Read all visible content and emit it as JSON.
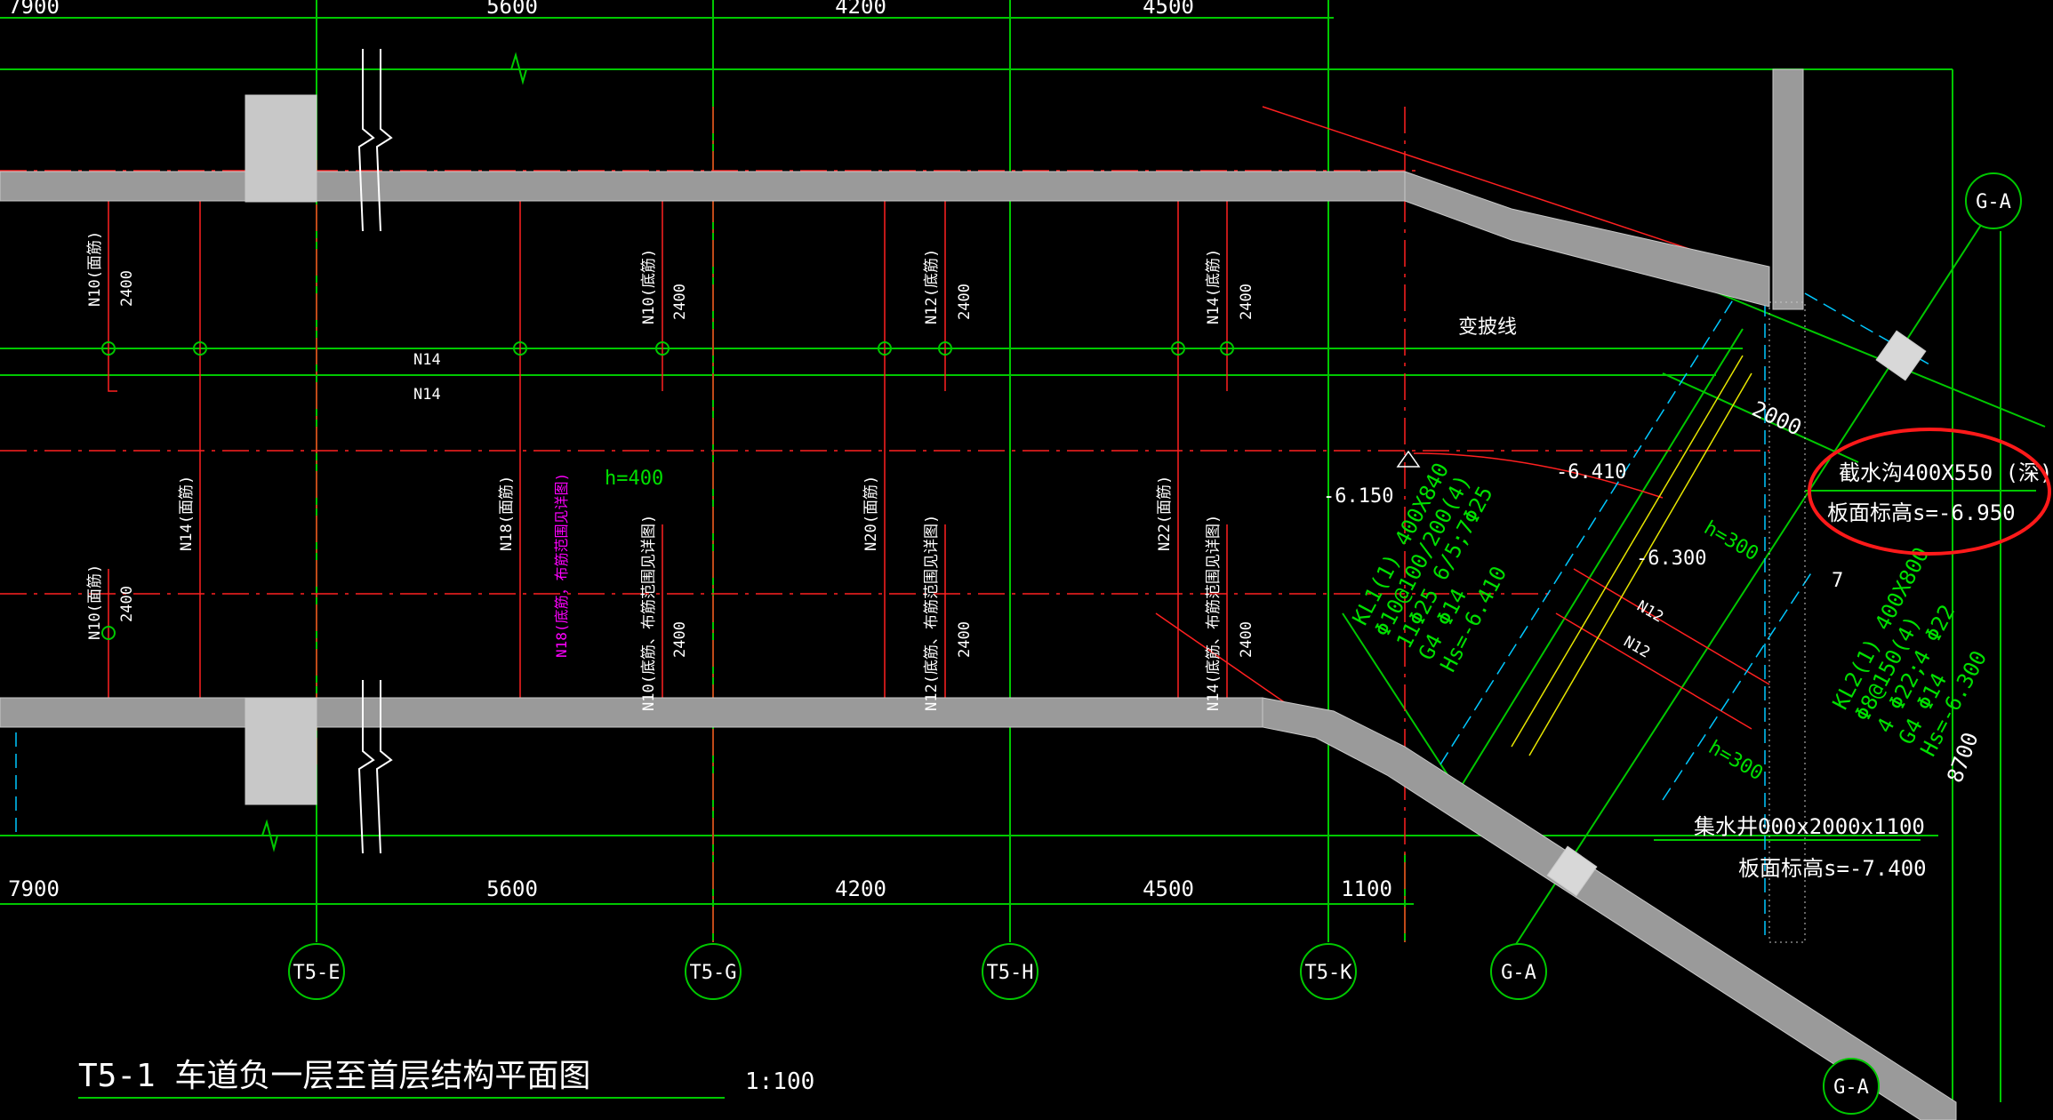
{
  "drawing": {
    "title": "T5-1 车道负一层至首层结构平面图",
    "scale": "1:100"
  },
  "dimensions": {
    "top": [
      "7900",
      "5600",
      "4200",
      "4500"
    ],
    "bottom": [
      "7900",
      "5600",
      "4200",
      "4500",
      "1100"
    ],
    "right": "8700",
    "diagonal": "2000"
  },
  "axis_bubbles": [
    "T5-E",
    "T5-G",
    "T5-H",
    "T5-K",
    "G-A",
    "G-A",
    "G-A"
  ],
  "rebar_labels": {
    "n10_top": "N10(面筋)",
    "n10_bot": "N10(面筋)",
    "n14_mid": "N14(面筋)",
    "n18_mid": "N18(面筋)",
    "n18_magenta": "N18(底筋，布筋范围见详图)",
    "n10_b": "N10(底筋)",
    "n10_b2": "N10(底筋、布筋范围见详图)",
    "n20": "N20(面筋)",
    "n12_b": "N12(底筋)",
    "n12_b2": "N12(底筋、布筋范围见详图)",
    "n14_b": "N14(底筋)",
    "n22": "N22(面筋)",
    "n14_b2": "N14(底筋、布筋范围见详图)",
    "n14_line1": "N14",
    "n14_line2": "N14",
    "n12_a": "N12",
    "n12_b_diag": "N12",
    "len_2400": "2400"
  },
  "annotations": {
    "slope_line": "变披线",
    "h400": "h=400",
    "h300_a": "h=300",
    "h300_b": "h=300",
    "elev_6150": "-6.150",
    "elev_6410": "-6.410",
    "elev_6300": "-6.300",
    "kl1_l1": "KL1(1) 400X840",
    "kl1_l2": "Φ10@100/200(4)",
    "kl1_l3": "11Φ25 6/5;7Φ25",
    "kl1_l4": "G4 Φ14",
    "kl1_l5": "Hs=-6.410",
    "kl2_l1": "KL2(1) 400X800",
    "kl2_l2": "Φ8@150(4)",
    "kl2_l3": "4 Φ22;4 Φ22",
    "kl2_l4": "G4 Φ14",
    "kl2_l5": "Hs=-6.300",
    "trench_l1": "截水沟400X550 (深)",
    "trench_l2": "板面标高s=-6.950",
    "sump_l1": "集水井000x2000x1100",
    "sump_l2": "板面标高s=-7.400",
    "note_7": "7"
  },
  "colors": {
    "background": "#000000",
    "grid": "#00c800",
    "wall": "#9a9a9a",
    "red": "#ff2020",
    "cyan": "#00c8ff",
    "white": "#ffffff",
    "magenta": "#ff00ff",
    "yellow": "#e6e600",
    "highlight_circle": "#ff1a1a"
  }
}
